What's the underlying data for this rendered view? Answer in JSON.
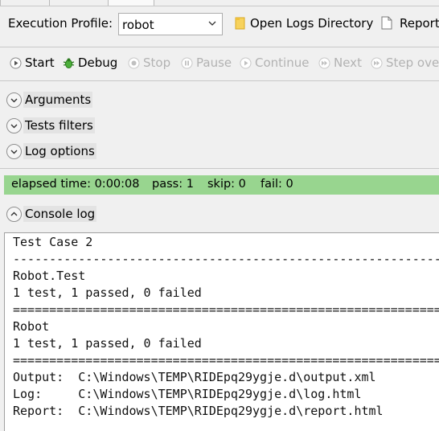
{
  "profile": {
    "label": "Execution Profile:",
    "selected": "robot",
    "open_logs_label": "Open Logs Directory",
    "report_label": "Report"
  },
  "toolbar": {
    "start": "Start",
    "debug": "Debug",
    "stop": "Stop",
    "pause": "Pause",
    "continue": "Continue",
    "next": "Next",
    "step_over": "Step ove"
  },
  "sections": {
    "arguments": "Arguments",
    "tests_filters": "Tests filters",
    "log_options": "Log options",
    "console_log": "Console log"
  },
  "status": {
    "elapsed": "elapsed time: 0:00:08",
    "pass": "pass: 1",
    "skip": "skip: 0",
    "fail": "fail: 0",
    "color": "#98d58f"
  },
  "console": {
    "lines": [
      "Test Case 2",
      "------------------------------------------------------------------------------",
      "Robot.Test",
      "1 test, 1 passed, 0 failed",
      "==============================================================================",
      "Robot",
      "1 test, 1 passed, 0 failed",
      "==============================================================================",
      "Output:  C:\\Windows\\TEMP\\RIDEpq29ygje.d\\output.xml",
      "Log:     C:\\Windows\\TEMP\\RIDEpq29ygje.d\\log.html",
      "Report:  C:\\Windows\\TEMP\\RIDEpq29ygje.d\\report.html"
    ]
  }
}
